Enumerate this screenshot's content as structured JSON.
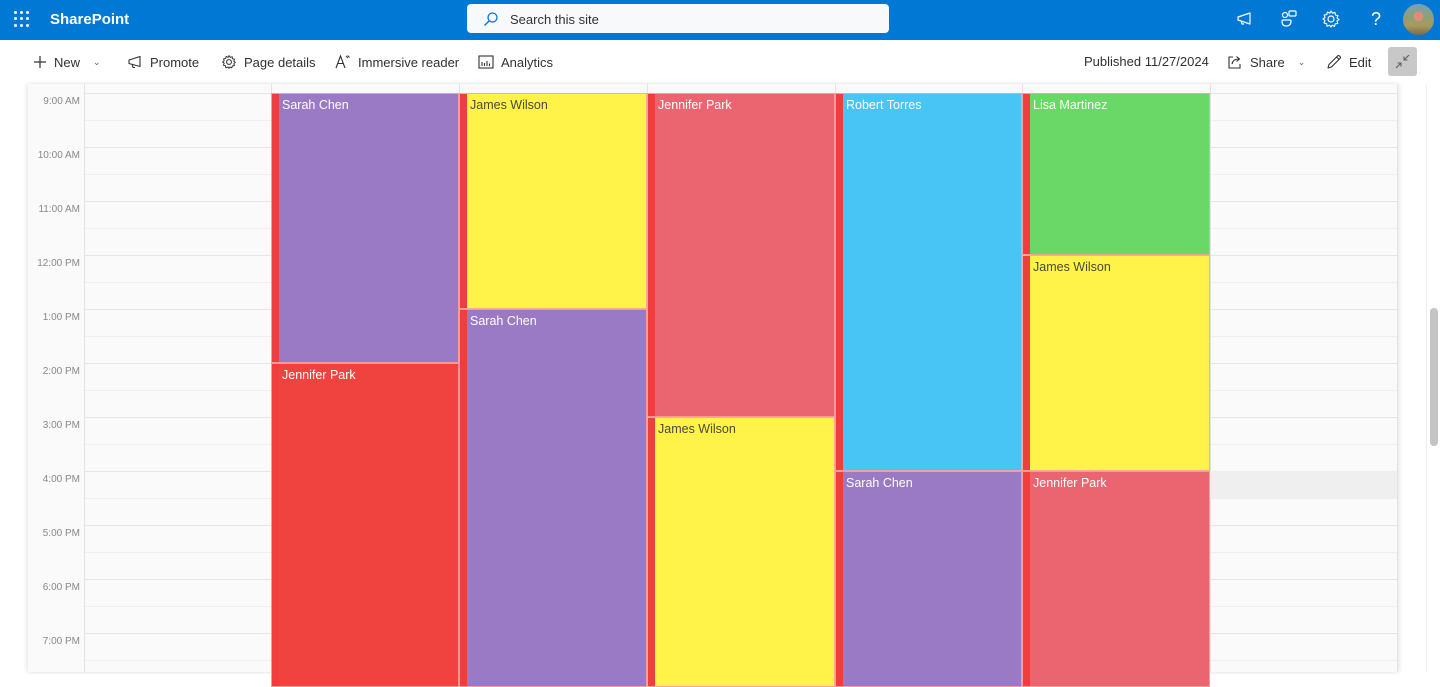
{
  "suitebar": {
    "app_name": "SharePoint",
    "search_placeholder": "Search this site",
    "icons": [
      "app-launcher-icon",
      "megaphone-icon",
      "feedback-icon",
      "settings-gear-icon",
      "help-question-icon",
      "user-avatar"
    ],
    "color": "#0078d4"
  },
  "commandbar": {
    "new_label": "New",
    "promote_label": "Promote",
    "page_details_label": "Page details",
    "immersive_reader_label": "Immersive reader",
    "analytics_label": "Analytics",
    "published_label": "Published 11/27/2024",
    "share_label": "Share",
    "edit_label": "Edit"
  },
  "calendar": {
    "time_labels": [
      "9:00 AM",
      "10:00 AM",
      "11:00 AM",
      "12:00 PM",
      "1:00 PM",
      "2:00 PM",
      "3:00 PM",
      "4:00 PM",
      "5:00 PM",
      "6:00 PM",
      "7:00 PM"
    ],
    "columns": [
      {
        "events": []
      },
      {
        "events": [
          {
            "name": "Sarah Chen",
            "start": "9:00",
            "end": "14:00",
            "color": "#9a7ac4",
            "text_color": "#ffffff"
          },
          {
            "name": "Jennifer Park",
            "start": "14:00",
            "end": "20:00",
            "color": "#f0423e",
            "text_color": "#ffffff"
          }
        ]
      },
      {
        "events": [
          {
            "name": "James Wilson",
            "start": "9:00",
            "end": "13:00",
            "color": "#fff34a",
            "text_color": "#4a4a3a"
          },
          {
            "name": "Sarah Chen",
            "start": "13:00",
            "end": "20:00",
            "color": "#9a7ac4",
            "text_color": "#ffffff"
          }
        ]
      },
      {
        "events": [
          {
            "name": "Jennifer Park",
            "start": "9:00",
            "end": "15:00",
            "color": "#ea6570",
            "text_color": "#ffffff"
          },
          {
            "name": "James Wilson",
            "start": "15:00",
            "end": "20:00",
            "color": "#fff34a",
            "text_color": "#4a4a3a"
          }
        ]
      },
      {
        "events": [
          {
            "name": "Robert Torres",
            "start": "9:00",
            "end": "16:00",
            "color": "#48c5f4",
            "text_color": "#ffffff"
          },
          {
            "name": "Sarah Chen",
            "start": "16:00",
            "end": "20:00",
            "color": "#9a7ac4",
            "text_color": "#ffffff"
          }
        ]
      },
      {
        "events": [
          {
            "name": "Lisa Martinez",
            "start": "9:00",
            "end": "12:00",
            "color": "#6ad866",
            "text_color": "#ffffff"
          },
          {
            "name": "James Wilson",
            "start": "12:00",
            "end": "16:00",
            "color": "#fff34a",
            "text_color": "#4a4a3a"
          },
          {
            "name": "Jennifer Park",
            "start": "16:00",
            "end": "20:00",
            "color": "#ea6570",
            "text_color": "#ffffff"
          }
        ]
      },
      {
        "events": []
      }
    ],
    "accent_bar_color": "#f03e3e"
  }
}
